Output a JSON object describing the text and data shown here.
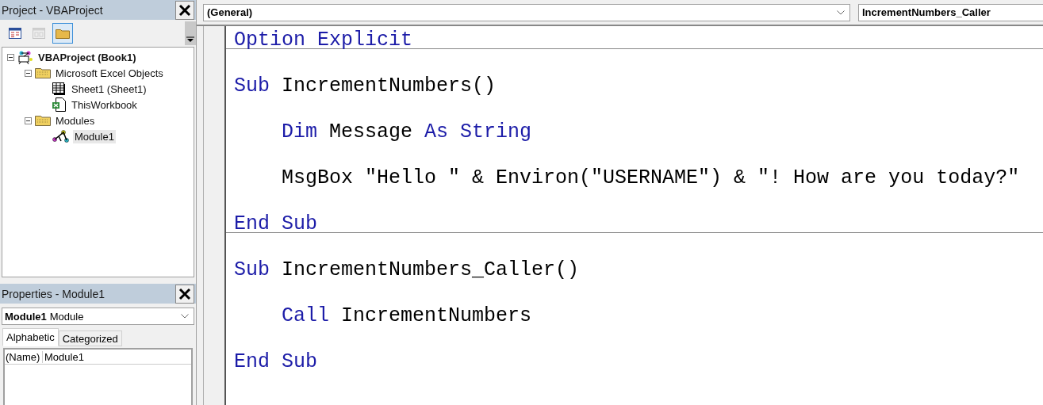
{
  "project_pane": {
    "title": "Project - VBAProject",
    "toolbar": [
      {
        "kind": "view-code",
        "disabled": false,
        "selected": false
      },
      {
        "kind": "view-object",
        "disabled": true,
        "selected": false
      },
      {
        "kind": "toggle-folders",
        "disabled": false,
        "selected": true
      }
    ],
    "tree": [
      {
        "label": "VBAProject (Book1)",
        "kind": "project",
        "expanded": true,
        "selected": false,
        "children": [
          {
            "label": "Microsoft Excel Objects",
            "kind": "folder",
            "expanded": true,
            "selected": false,
            "children": [
              {
                "label": "Sheet1 (Sheet1)",
                "kind": "sheet",
                "selected": false
              },
              {
                "label": "ThisWorkbook",
                "kind": "workbook",
                "selected": false
              }
            ]
          },
          {
            "label": "Modules",
            "kind": "folder",
            "expanded": true,
            "selected": false,
            "children": [
              {
                "label": "Module1",
                "kind": "module",
                "selected": true
              }
            ]
          }
        ]
      }
    ]
  },
  "properties_pane": {
    "title": "Properties - Module1",
    "object_name": "Module1",
    "object_type": "Module",
    "tabs": [
      {
        "label": "Alphabetic",
        "selected": true
      },
      {
        "label": "Categorized",
        "selected": false
      }
    ],
    "rows": [
      {
        "name": "(Name)",
        "value": "Module1"
      }
    ]
  },
  "code_window": {
    "object_box": "(General)",
    "procedure_box": "IncrementNumbers_Caller",
    "blocks": [
      {
        "lines": [
          [
            {
              "text": "Option Explicit",
              "kind": "keyword"
            }
          ]
        ]
      },
      {
        "lines": [
          [
            {
              "text": "Sub",
              "kind": "keyword"
            },
            {
              "text": " IncrementNumbers()",
              "kind": "plain"
            }
          ],
          [
            {
              "text": "Dim",
              "kind": "keyword",
              "indent": true
            },
            {
              "text": " Message ",
              "kind": "plain"
            },
            {
              "text": "As String",
              "kind": "keyword"
            }
          ],
          [
            {
              "indent": true,
              "text": "MsgBox \"Hello \" & Environ(\"USERNAME\") & \"! How are you today?\"",
              "kind": "plain"
            }
          ],
          [
            {
              "text": "End Sub",
              "kind": "keyword"
            }
          ]
        ]
      },
      {
        "lines": [
          [
            {
              "text": "Sub",
              "kind": "keyword"
            },
            {
              "text": " IncrementNumbers_Caller()",
              "kind": "plain"
            }
          ],
          [
            {
              "text": "Call",
              "kind": "keyword",
              "indent": true
            },
            {
              "text": " IncrementNumbers",
              "kind": "plain"
            }
          ],
          [
            {
              "text": "End Sub",
              "kind": "keyword"
            }
          ]
        ]
      }
    ]
  }
}
